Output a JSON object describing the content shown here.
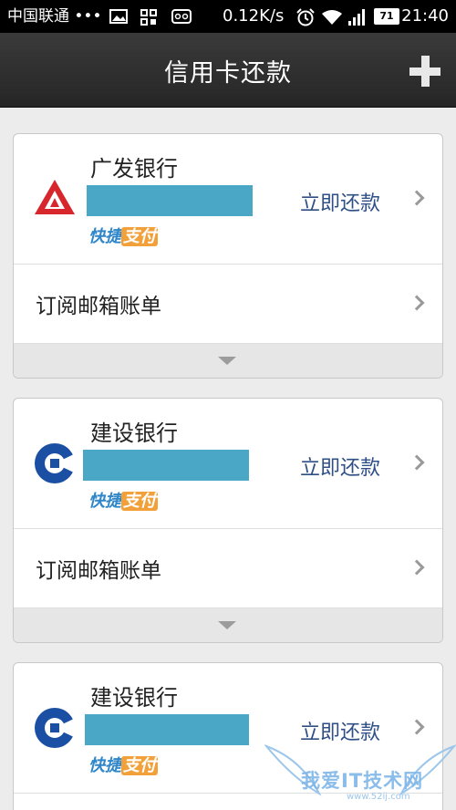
{
  "status_bar": {
    "carrier": "中国联通 •••",
    "speed": "0.12K/s",
    "battery": "71",
    "time": "21:40"
  },
  "header": {
    "title": "信用卡还款",
    "add_icon": "plus-icon"
  },
  "cards": [
    {
      "bank_name": "广发银行",
      "logo_icon": "cgb-bank-logo",
      "quickpay_a": "快捷",
      "quickpay_b": "支付",
      "pay_now_label": "立即还款",
      "subscribe_label": "订阅邮箱账单",
      "number_redaction_color": "#4aa8c6"
    },
    {
      "bank_name": "建设银行",
      "logo_icon": "ccb-bank-logo",
      "quickpay_a": "快捷",
      "quickpay_b": "支付",
      "pay_now_label": "立即还款",
      "subscribe_label": "订阅邮箱账单",
      "number_redaction_color": "#4aa8c6"
    },
    {
      "bank_name": "建设银行",
      "logo_icon": "ccb-bank-logo",
      "quickpay_a": "快捷",
      "quickpay_b": "支付",
      "pay_now_label": "立即还款",
      "number_redaction_color": "#4aa8c6"
    }
  ],
  "watermark": {
    "text": "我爱IT技术网",
    "sub": "www.52ij.com"
  }
}
